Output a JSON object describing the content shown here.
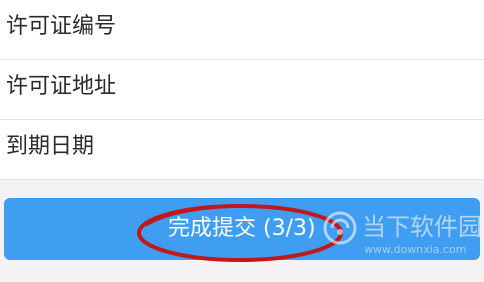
{
  "form": {
    "fields": [
      {
        "label": "许可证编号"
      },
      {
        "label": "许可证地址"
      },
      {
        "label": "到期日期"
      }
    ]
  },
  "submit": {
    "label": "完成提交 (3/3)"
  },
  "watermark": {
    "name": "当下软件园",
    "url": "www.downxia.com"
  },
  "colors": {
    "button": "#3f9df2",
    "highlight": "#c0191c",
    "background": "#f3f3f5"
  }
}
